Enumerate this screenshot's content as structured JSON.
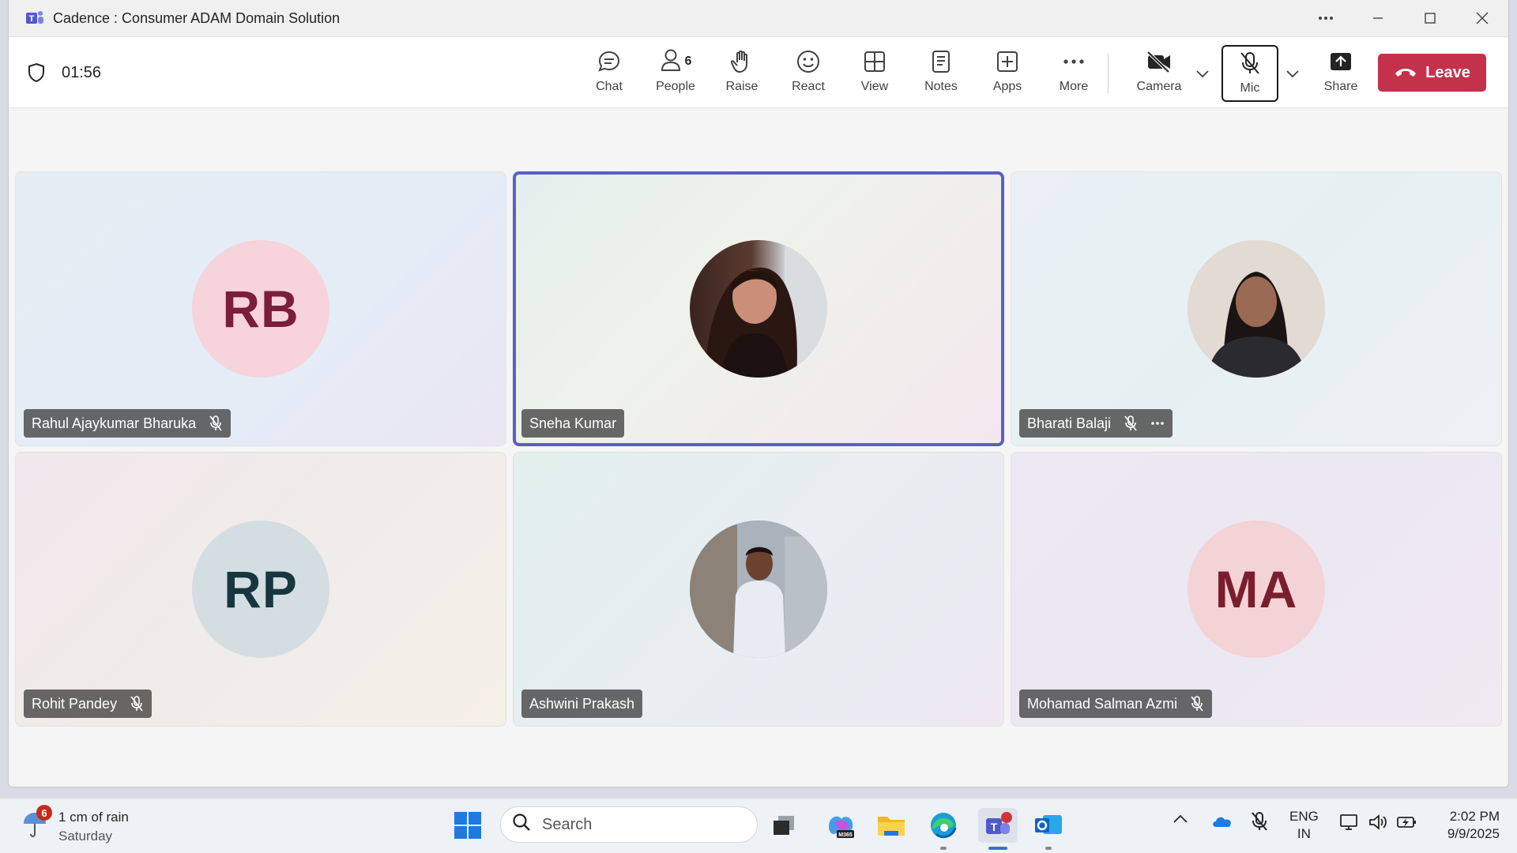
{
  "window": {
    "title": "Cadence : Consumer ADAM Domain Solution"
  },
  "toolbar": {
    "timer": "01:56",
    "chat_label": "Chat",
    "people_label": "People",
    "people_count": "6",
    "raise_label": "Raise",
    "react_label": "React",
    "view_label": "View",
    "notes_label": "Notes",
    "apps_label": "Apps",
    "more_label": "More",
    "camera_label": "Camera",
    "mic_label": "Mic",
    "share_label": "Share",
    "leave_label": "Leave"
  },
  "participants": [
    {
      "name": "Rahul Ajaykumar Bharuka",
      "initials": "RB",
      "muted": true,
      "avatar_bg": "#f7d3dc",
      "initials_color": "#7a1e3a"
    },
    {
      "name": "Sneha Kumar",
      "initials": "",
      "muted": false,
      "active_speaker": true
    },
    {
      "name": "Bharati Balaji",
      "initials": "",
      "muted": true,
      "more_options": true
    },
    {
      "name": "Rohit Pandey",
      "initials": "RP",
      "muted": true,
      "avatar_bg": "#d3dde2",
      "initials_color": "#18363e"
    },
    {
      "name": "Ashwini Prakash",
      "initials": "",
      "muted": false
    },
    {
      "name": "Mohamad Salman Azmi",
      "initials": "MA",
      "muted": true,
      "avatar_bg": "#f3d3d6",
      "initials_color": "#7a1e2e"
    }
  ],
  "taskbar": {
    "weather_badge": "6",
    "weather_line1": "1 cm of rain",
    "weather_line2": "Saturday",
    "search_placeholder": "Search",
    "lang_line1": "ENG",
    "lang_line2": "IN",
    "time": "2:02 PM",
    "date": "9/9/2025"
  },
  "colors": {
    "accent": "#5b5fc7",
    "leave": "#c4314b"
  }
}
